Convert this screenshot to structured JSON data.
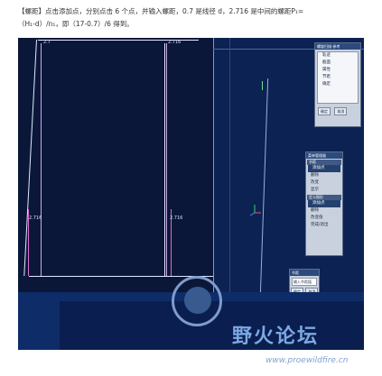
{
  "caption": {
    "line1": "【螺距】点击添加点，分别点击 6 个点，并输入螺距，0.7 是线径 d，2.716 是中间的螺距P₁=",
    "line2": "（H₁-d）/n₁，即（17-0.7）/6 得到。"
  },
  "drawing": {
    "dim_top_left": "2.7",
    "dim_top_right": "2.716",
    "dim_mid_left": "2.716",
    "dim_mid_right": "2.716"
  },
  "panel_top": {
    "title": "螺旋扫描-参考",
    "items": [
      "轨迹",
      "截面",
      "属性",
      "节距",
      "确定"
    ],
    "btn_ok": "确定",
    "btn_cancel": "取消"
  },
  "panel_menu": {
    "title": "菜单管理器",
    "section1": "节距",
    "items1": [
      "添加点",
      "删除",
      "改变",
      "显示"
    ],
    "section2": "定义图形",
    "items2": [
      "添加点",
      "删除",
      "改变值",
      "完成/退出"
    ]
  },
  "panel_input": {
    "title": "节距",
    "prompt": "输入节距值",
    "btn_ok": "确定",
    "btn_cancel": "取消"
  },
  "watermark": {
    "text": "野火论坛",
    "url": "www.proewildfire.cn"
  },
  "colors": {
    "background": "#0c2253",
    "panel": "#c9d1de",
    "accent": "#2b4a7e",
    "watermark": "#7da8e2"
  }
}
